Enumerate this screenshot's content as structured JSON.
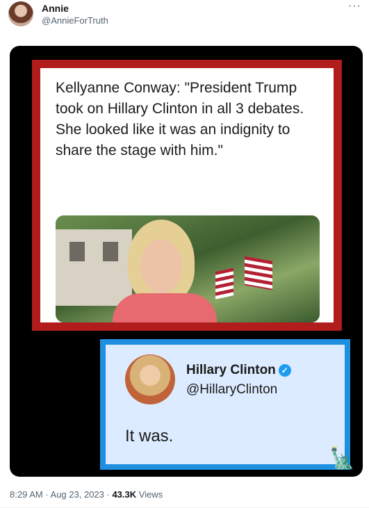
{
  "tweet": {
    "author_name": "Annie",
    "author_handle": "@AnnieForTruth",
    "more_icon": "more-dots-icon",
    "timestamp": "8:29 AM · Aug 23, 2023 · ",
    "views_count": "43.3K",
    "views_label": " Views"
  },
  "media": {
    "quote_text": "Kellyanne Conway: \"President Trump took on Hillary Clinton in all 3 debates. She looked like it was an indignity to share the stage with him.\"",
    "reply": {
      "name": "Hillary Clinton",
      "handle": "@HillaryClinton",
      "text": "It was.",
      "verified_icon": "verified-badge-icon"
    },
    "watermark_icon": "statue-of-liberty-icon"
  },
  "colors": {
    "red_frame": "#b11c1c",
    "blue_frame": "#1f8fe0",
    "verified": "#1d9bf0"
  }
}
